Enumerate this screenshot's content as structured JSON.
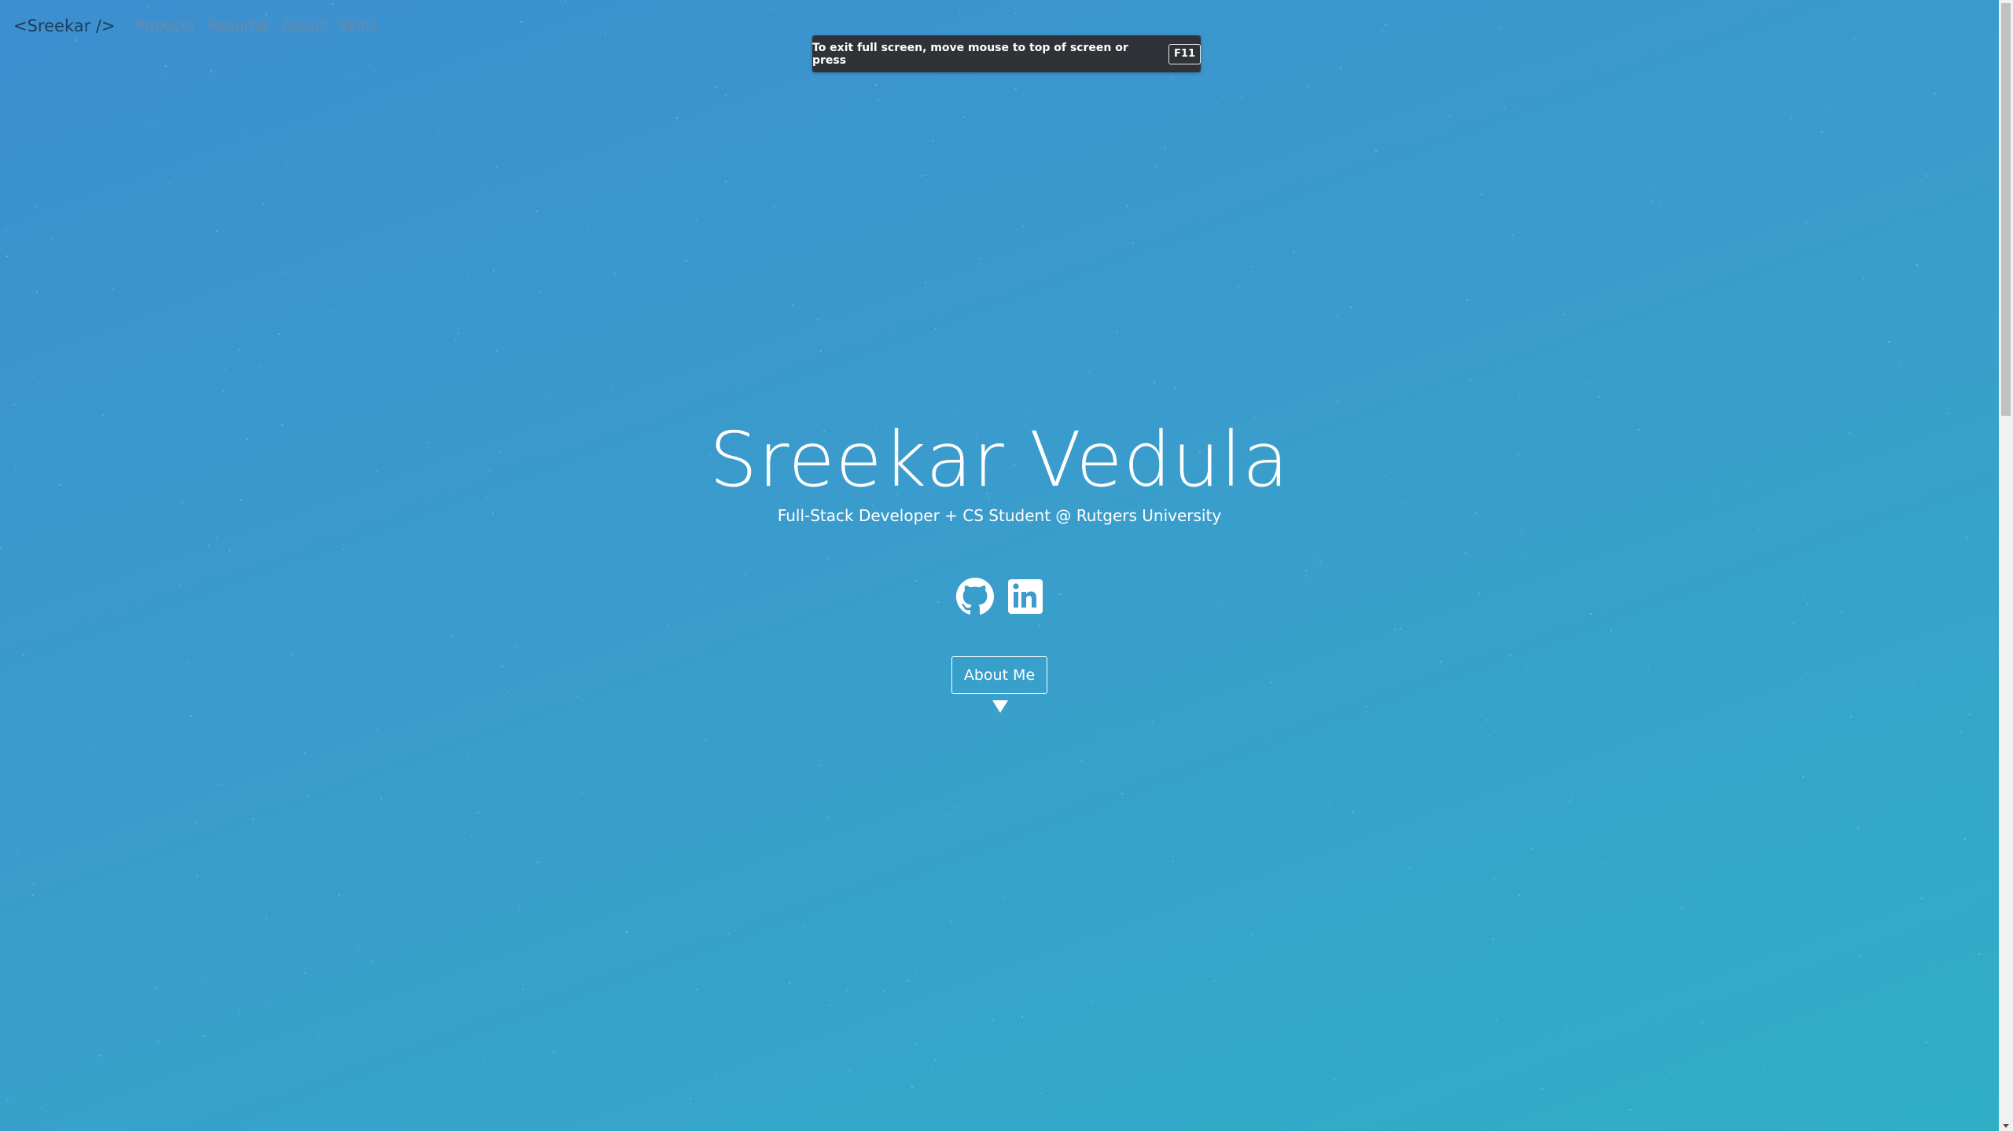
{
  "nav": {
    "brand": "<Sreekar />",
    "links": [
      "Projects",
      "Resume",
      "About",
      "Skills"
    ]
  },
  "fullscreen_notice": {
    "text": "To exit full screen, move mouse to top of screen or press",
    "key": "F11"
  },
  "hero": {
    "name": "Sreekar Vedula",
    "subtitle": "Full-Stack Developer + CS Student @ Rutgers University",
    "socials": [
      {
        "icon": "github-icon",
        "label": "GitHub"
      },
      {
        "icon": "linkedin-icon",
        "label": "LinkedIn"
      }
    ],
    "cta_label": "About Me"
  },
  "colors": {
    "background_start": "#3d8fcf",
    "background_end": "#30aec6",
    "brand_text": "#1f3b57",
    "nav_link": "#6b8aa8",
    "toast_bg": "#2f3236"
  }
}
